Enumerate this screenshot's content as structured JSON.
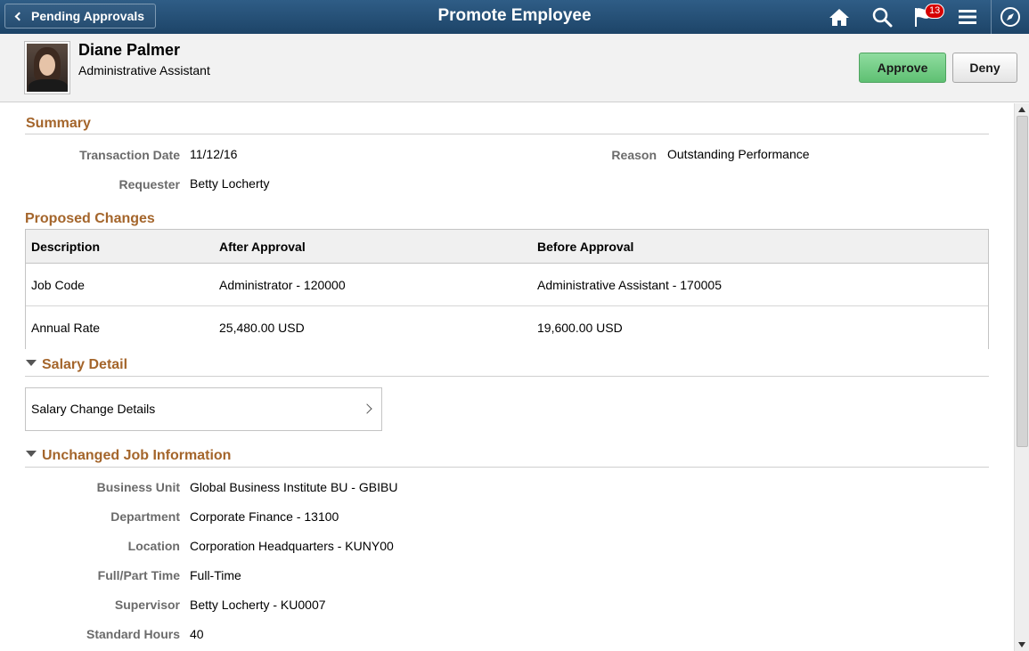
{
  "banner": {
    "back_label": "Pending Approvals",
    "title": "Promote Employee",
    "notification_count": "13",
    "icons": [
      "home-icon",
      "search-icon",
      "notifications-flag-icon",
      "menu-icon",
      "navbar-compass-icon"
    ]
  },
  "employee": {
    "name": "Diane Palmer",
    "job_title": "Administrative Assistant"
  },
  "actions": {
    "approve_label": "Approve",
    "deny_label": "Deny"
  },
  "summary": {
    "heading": "Summary",
    "transaction_date_label": "Transaction Date",
    "transaction_date": "11/12/16",
    "requester_label": "Requester",
    "requester": "Betty Locherty",
    "reason_label": "Reason",
    "reason": "Outstanding Performance"
  },
  "proposed_changes": {
    "heading": "Proposed Changes",
    "columns": [
      "Description",
      "After Approval",
      "Before Approval"
    ],
    "rows": [
      {
        "description": "Job Code",
        "after": "Administrator - 120000",
        "before": "Administrative Assistant - 170005"
      },
      {
        "description": "Annual Rate",
        "after": "25,480.00 USD",
        "before": "19,600.00 USD"
      }
    ]
  },
  "salary_detail": {
    "heading": "Salary Detail",
    "card_label": "Salary Change Details"
  },
  "unchanged_job": {
    "heading": "Unchanged Job Information",
    "fields": [
      {
        "label": "Business Unit",
        "value": "Global Business Institute BU - GBIBU"
      },
      {
        "label": "Department",
        "value": "Corporate Finance - 13100"
      },
      {
        "label": "Location",
        "value": "Corporation Headquarters - KUNY00"
      },
      {
        "label": "Full/Part Time",
        "value": "Full-Time"
      },
      {
        "label": "Supervisor",
        "value": "Betty Locherty - KU0007"
      },
      {
        "label": "Standard Hours",
        "value": "40"
      }
    ]
  },
  "colors": {
    "banner": "#1d4468",
    "section_heading": "#a4652b",
    "approve": "#5fc073"
  }
}
